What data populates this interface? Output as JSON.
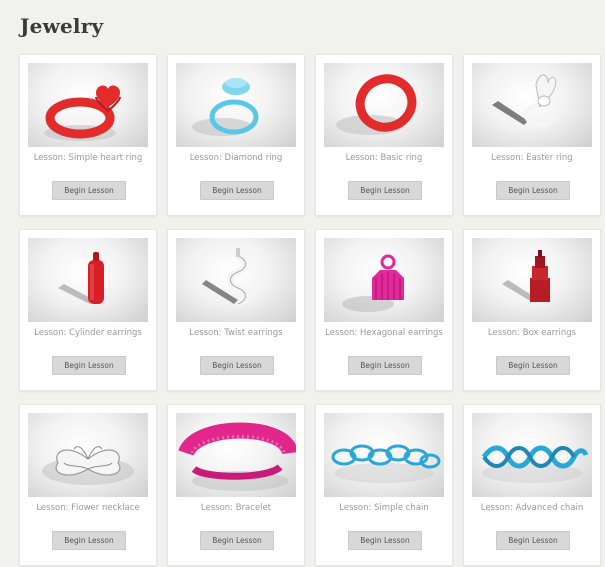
{
  "section": {
    "title": "Jewelry"
  },
  "lessons": [
    {
      "label": "Lesson: Simple heart ring",
      "button": "Begin Lesson",
      "thumb": "heart-ring",
      "color": "#e22b2b"
    },
    {
      "label": "Lesson: Diamond ring",
      "button": "Begin Lesson",
      "thumb": "diamond-ring",
      "color": "#59c8e8"
    },
    {
      "label": "Lesson: Basic ring",
      "button": "Begin Lesson",
      "thumb": "basic-ring",
      "color": "#e22b2b"
    },
    {
      "label": "Lesson: Easter ring",
      "button": "Begin Lesson",
      "thumb": "easter-ring",
      "color": "#f2f2f2"
    },
    {
      "label": "Lesson: Cylinder earrings",
      "button": "Begin Lesson",
      "thumb": "cylinder-earring",
      "color": "#d61e24"
    },
    {
      "label": "Lesson: Twist earrings",
      "button": "Begin Lesson",
      "thumb": "twist-earring",
      "color": "#f2f2f2"
    },
    {
      "label": "Lesson: Hexagonal earrings",
      "button": "Begin Lesson",
      "thumb": "hexagonal-earring",
      "color": "#e02a9a"
    },
    {
      "label": "Lesson: Box earrings",
      "button": "Begin Lesson",
      "thumb": "box-earring",
      "color": "#b81c25"
    },
    {
      "label": "Lesson: Flower necklace",
      "button": "Begin Lesson",
      "thumb": "flower-necklace",
      "color": "#f5f5f5"
    },
    {
      "label": "Lesson: Bracelet",
      "button": "Begin Lesson",
      "thumb": "bracelet",
      "color": "#e1268c"
    },
    {
      "label": "Lesson: Simple chain",
      "button": "Begin Lesson",
      "thumb": "simple-chain",
      "color": "#2aa7d6"
    },
    {
      "label": "Lesson: Advanced chain",
      "button": "Begin Lesson",
      "thumb": "advanced-chain",
      "color": "#2aa7d6"
    }
  ]
}
